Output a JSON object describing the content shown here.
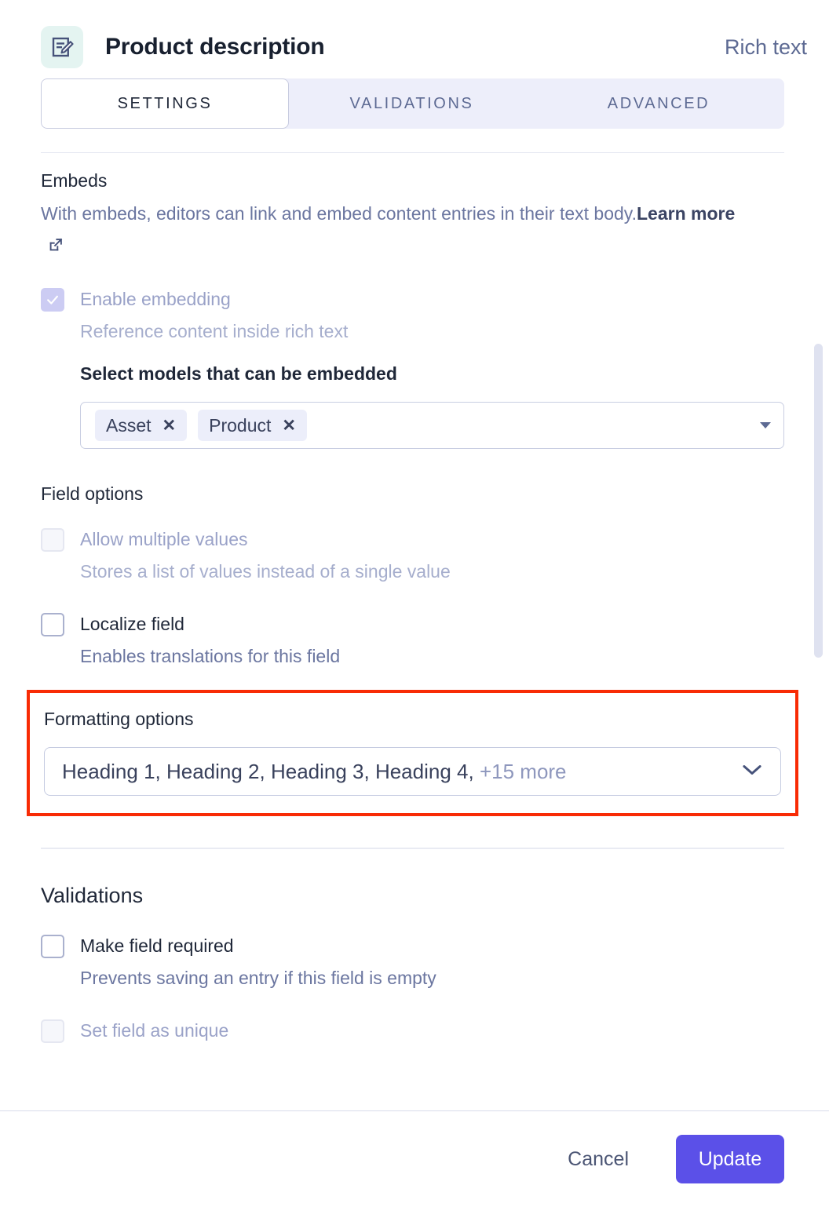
{
  "header": {
    "icon": "rich-text-document-icon",
    "title": "Product description",
    "field_type": "Rich text"
  },
  "tabs": [
    {
      "label": "SETTINGS",
      "active": true
    },
    {
      "label": "VALIDATIONS",
      "active": false
    },
    {
      "label": "ADVANCED",
      "active": false
    }
  ],
  "embeds": {
    "title": "Embeds",
    "description": "With embeds, editors can link and embed content entries in their text body.",
    "learn_more": "Learn more",
    "learn_more_icon": "external-link-icon",
    "enable": {
      "label": "Enable embedding",
      "description": "Reference content inside rich text",
      "checked": true,
      "disabled": true
    },
    "models_label": "Select models that can be embedded",
    "models": [
      "Asset",
      "Product"
    ],
    "remove_icon": "close-icon",
    "dropdown_icon": "caret-down-icon"
  },
  "field_options": {
    "title": "Field options",
    "items": [
      {
        "label": "Allow multiple values",
        "description": "Stores a list of values instead of a single value",
        "checked": false,
        "disabled": true
      },
      {
        "label": "Localize field",
        "description": "Enables translations for this field",
        "checked": false,
        "disabled": false
      }
    ]
  },
  "formatting": {
    "title": "Formatting options",
    "selected_text": "Heading 1, Heading 2, Heading 3, Heading 4,",
    "more_text": "+15 more",
    "chevron_icon": "chevron-down-icon",
    "highlight_color": "#f82b05"
  },
  "validations": {
    "title": "Validations",
    "items": [
      {
        "label": "Make field required",
        "description": "Prevents saving an entry if this field is empty",
        "checked": false,
        "disabled": false
      },
      {
        "label": "Set field as unique",
        "description": "",
        "checked": false,
        "disabled": true
      }
    ]
  },
  "footer": {
    "cancel_label": "Cancel",
    "update_label": "Update",
    "update_color": "#5b50e8"
  }
}
